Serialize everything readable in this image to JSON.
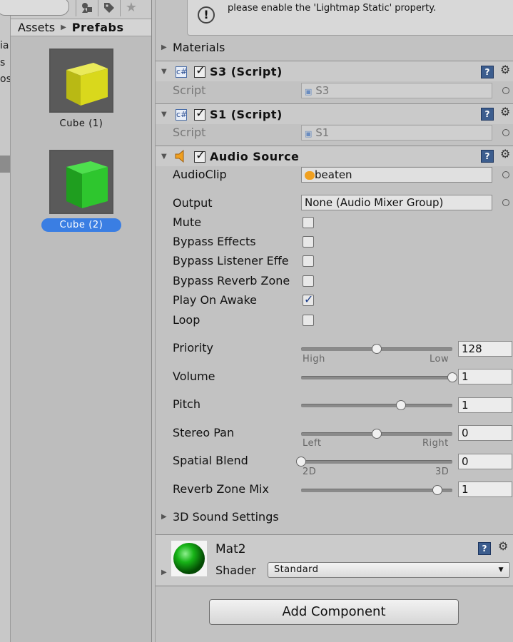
{
  "left_strip": {
    "labels": [
      "ia",
      "s",
      "os"
    ]
  },
  "project": {
    "breadcrumb": {
      "root": "Assets",
      "current": "Prefabs"
    },
    "assets": [
      {
        "label": "Cube (1)",
        "color": "#d9d81c",
        "selected": false
      },
      {
        "label": "Cube (2)",
        "color": "#2ec62e",
        "selected": true
      }
    ]
  },
  "inspector": {
    "help_text": "To enable generation of lightmaps for this Mesh Renderer, please enable the 'Lightmap Static' property.",
    "materials_label": "Materials",
    "s3": {
      "title": "S3 (Script)",
      "script_label": "Script",
      "script_value": "S3"
    },
    "s1": {
      "title": "S1 (Script)",
      "script_label": "Script",
      "script_value": "S1"
    },
    "audio": {
      "title": "Audio Source",
      "audioclip_label": "AudioClip",
      "audioclip_value": "beaten",
      "output_label": "Output",
      "output_value": "None (Audio Mixer Group)",
      "mute_label": "Mute",
      "bypass_effects_label": "Bypass Effects",
      "bypass_listener_label": "Bypass Listener Effe",
      "bypass_reverb_label": "Bypass Reverb Zone",
      "play_on_awake_label": "Play On Awake",
      "loop_label": "Loop",
      "priority": {
        "label": "Priority",
        "value": "128",
        "fraction": 0.5,
        "min_label": "High",
        "max_label": "Low"
      },
      "volume": {
        "label": "Volume",
        "value": "1",
        "fraction": 1.0
      },
      "pitch": {
        "label": "Pitch",
        "value": "1",
        "fraction": 0.66
      },
      "stereo_pan": {
        "label": "Stereo Pan",
        "value": "0",
        "fraction": 0.5,
        "min_label": "Left",
        "max_label": "Right"
      },
      "spatial_blend": {
        "label": "Spatial Blend",
        "value": "0",
        "fraction": 0.0,
        "min_label": "2D",
        "max_label": "3D"
      },
      "reverb_zone_mix": {
        "label": "Reverb Zone Mix",
        "value": "1",
        "fraction": 0.9
      },
      "sound_settings_label": "3D Sound Settings"
    },
    "material": {
      "name": "Mat2",
      "shader_label": "Shader",
      "shader_value": "Standard"
    },
    "add_component_label": "Add Component"
  }
}
